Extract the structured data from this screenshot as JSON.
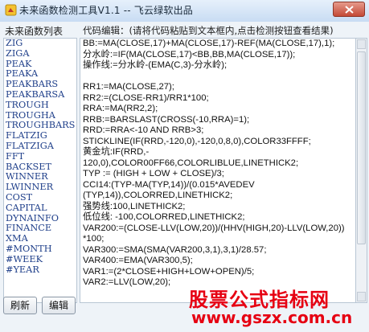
{
  "window": {
    "title": "未来函数检测工具V1.1 -- 飞云绿软出品",
    "close_symbol": "×"
  },
  "function_list": {
    "label": "未来函数列表",
    "items": [
      "ZIG",
      "ZIGA",
      "PEAK",
      "PEAKA",
      "PEAKBARS",
      "PEAKBARSA",
      "TROUGH",
      "TROUGHA",
      "TROUGHBARS",
      "FLATZIG",
      "FLATZIGA",
      "FFT",
      "BACKSET",
      "WINNER",
      "LWINNER",
      "COST",
      "CAPITAL",
      "DYNAINFO",
      "FINANCE",
      "XMA",
      "#MONTH",
      "#WEEK",
      "#YEAR"
    ]
  },
  "code_editor": {
    "label": "代码编辑：(请将代码粘贴到文本框内,点击检测按钮查看结果)",
    "lines": [
      "BB:=MA(CLOSE,17)+MA(CLOSE,17)-REF(MA(CLOSE,17),1);",
      "分水岭:=IF(MA(CLOSE,17)<BB,BB,MA(CLOSE,17));",
      "操作线:=分水岭-(EMA(C,3)-分水岭);",
      "",
      "RR1:=MA(CLOSE,27);",
      "RR2:=(CLOSE-RR1)/RR1*100;",
      "RRA:=MA(RR2,2);",
      "RRB:=BARSLAST(CROSS(-10,RRA)=1);",
      "RRD:=RRA<-10 AND RRB>3;",
      "STICKLINE(IF(RRD,-120,0),-120,0,8,0),COLOR33FFFF;",
      "黄金坑:IF(RRD,-",
      "120,0),COLOR00FF66,COLORLIBLUE,LINETHICK2;",
      "TYP := (HIGH + LOW + CLOSE)/3;",
      "CCI14:(TYP-MA(TYP,14))/(0.015*AVEDEV",
      "(TYP,14)),COLORRED,LINETHICK2;",
      "强势线:100,LINETHICK2;",
      "低位线: -100,COLORRED,LINETHICK2;",
      "VAR200:=(CLOSE-LLV(LOW,20))/(HHV(HIGH,20)-LLV(LOW,20))",
      "*100;",
      "VAR300:=SMA(SMA(VAR200,3,1),3,1)/28.57;",
      "VAR400:=EMA(VAR300,5);",
      "VAR1:=(2*CLOSE+HIGH+LOW+OPEN)/5;",
      "VAR2:=LLV(LOW,20);"
    ]
  },
  "buttons": {
    "refresh": "刷新",
    "edit": "编辑"
  },
  "watermark": {
    "site_name": "股票公式指标网",
    "url": "www.gszx.com.cn"
  },
  "colors": {
    "function_item": "#1f3f8a",
    "close_button": "#c44a36",
    "watermark": "#e60012"
  }
}
